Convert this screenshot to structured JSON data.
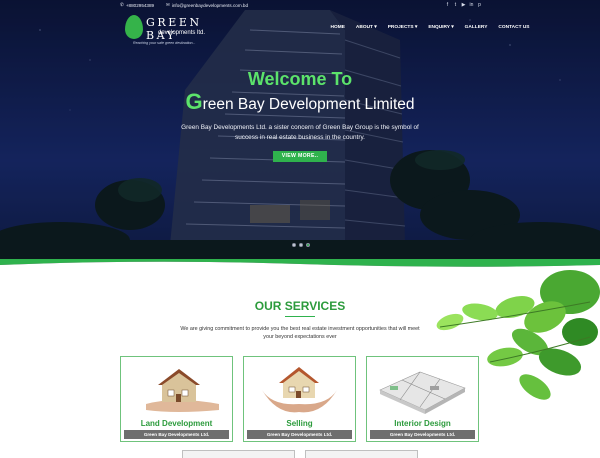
{
  "topbar": {
    "phone": "+8802954389",
    "email": "info@greenbaydevelopments.com.bd",
    "social_icons": [
      "facebook-icon",
      "twitter-icon",
      "youtube-icon",
      "linkedin-icon",
      "pinterest-icon"
    ],
    "social_glyphs": [
      "f",
      "t",
      "▶",
      "in",
      "p"
    ]
  },
  "logo": {
    "brand": "GREEN BAY",
    "sub": "developments ltd.",
    "tagline": "Reaching your safe green destination..."
  },
  "nav": {
    "items": [
      {
        "label": "HOME"
      },
      {
        "label": "ABOUT ▾"
      },
      {
        "label": "PROJECTS ▾"
      },
      {
        "label": "ENQUIRY ▾"
      },
      {
        "label": "GALLERY"
      },
      {
        "label": "CONTACT US"
      }
    ]
  },
  "hero": {
    "welcome": "Welcome To",
    "company_first_letter": "G",
    "company_rest": "reen Bay Development Limited",
    "intro": "Green Bay Developments Ltd. a sister concern of Green Bay Group is the symbol of success in real estate business in the country.",
    "button": "VIEW MORE..",
    "slides": 3,
    "active_slide": 3
  },
  "services": {
    "title": "OUR SERVICES",
    "text": "We are giving commitment to provide you the best real estate investment opportunities that will meet your beyond expectations ever",
    "cards": [
      {
        "title": "Land Development",
        "company": "Green Bay Developments Ltd."
      },
      {
        "title": "Selling",
        "company": "Green Bay Developments Ltd."
      },
      {
        "title": "Interior Design",
        "company": "Green Bay Developments Ltd."
      }
    ]
  },
  "colors": {
    "accent_green": "#2fb24d",
    "heading_green": "#2c9b3c",
    "hero_bg": "#111f52"
  }
}
